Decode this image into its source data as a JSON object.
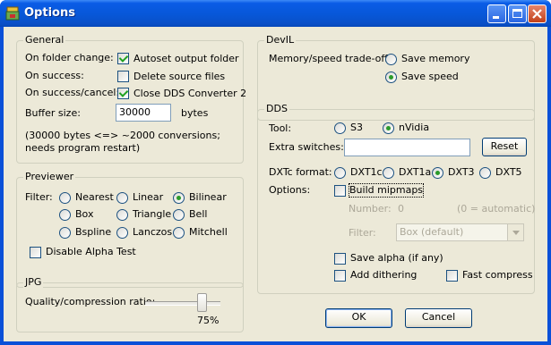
{
  "window": {
    "title": "Options",
    "icon": "app-icon"
  },
  "general": {
    "legend": "General",
    "folder_change_label": "On folder change:",
    "autoset_label": "Autoset output folder",
    "autoset_checked": true,
    "success_label": "On success:",
    "delete_label": "Delete source files",
    "delete_checked": false,
    "success_cancel_label": "On success/cancel:",
    "close_label": "Close DDS Converter 2",
    "close_checked": true,
    "buffer_label": "Buffer size:",
    "buffer_value": "30000",
    "buffer_unit": "bytes",
    "note_line1": "(30000 bytes <=> ~2000 conversions;",
    "note_line2": "needs program restart)"
  },
  "previewer": {
    "legend": "Previewer",
    "filter_label": "Filter:",
    "filters": [
      "Nearest",
      "Linear",
      "Bilinear",
      "Box",
      "Triangle",
      "Bell",
      "Bspline",
      "Lanczos",
      "Mitchell"
    ],
    "selected_filter": "Bilinear",
    "disable_alpha_label": "Disable Alpha Test",
    "disable_alpha_checked": false
  },
  "jpg": {
    "legend": "JPG",
    "quality_label": "Quality/compression ratio:",
    "quality_percent": 75,
    "quality_text": "75%"
  },
  "devil": {
    "legend": "DevIL",
    "tradeoff_label": "Memory/speed trade-off:",
    "save_memory_label": "Save memory",
    "save_speed_label": "Save speed",
    "selected": "Save speed"
  },
  "dds": {
    "legend": "DDS",
    "tool_label": "Tool:",
    "tool_s3": "S3",
    "tool_nvidia": "nVidia",
    "selected_tool": "nVidia",
    "extra_label": "Extra switches:",
    "extra_value": "",
    "reset_label": "Reset",
    "format_label": "DXTc format:",
    "formats": [
      "DXT1c",
      "DXT1a",
      "DXT3",
      "DXT5"
    ],
    "selected_format": "DXT3",
    "options_label": "Options:",
    "mipmaps_label": "Build mipmaps",
    "mipmaps_checked": false,
    "number_label": "Number:",
    "number_value": "0",
    "number_hint": "(0 = automatic)",
    "filter_label": "Filter:",
    "filter_value": "Box (default)",
    "save_alpha_label": "Save alpha (if any)",
    "save_alpha_checked": false,
    "dithering_label": "Add dithering",
    "dithering_checked": false,
    "fast_compress_label": "Fast compress",
    "fast_compress_checked": false
  },
  "buttons": {
    "ok": "OK",
    "cancel": "Cancel"
  }
}
